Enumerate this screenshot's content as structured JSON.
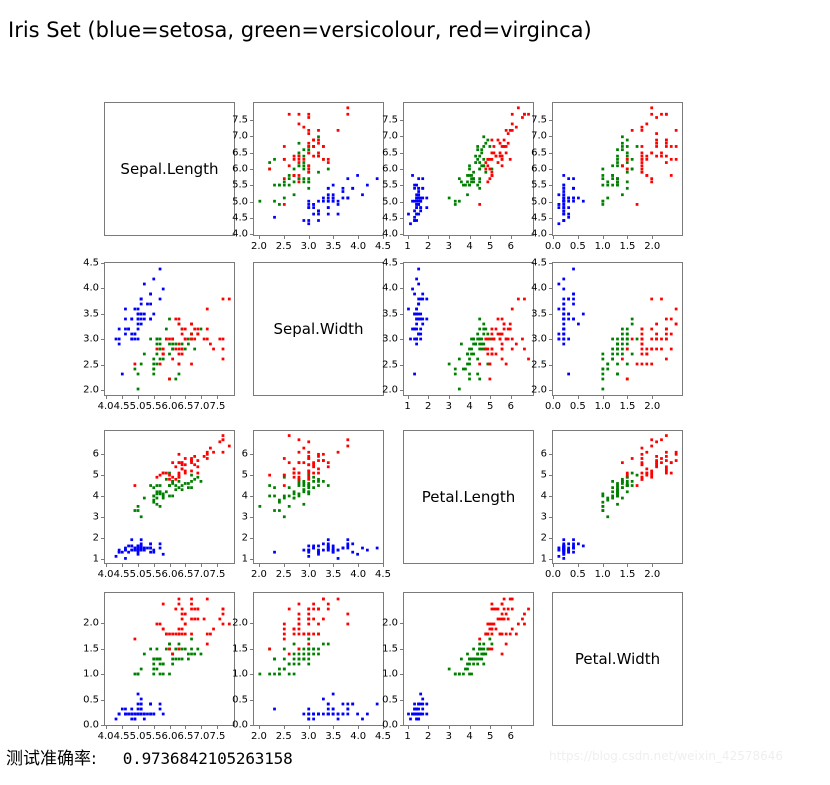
{
  "title": "Iris Set (blue=setosa, green=versicolour, red=virginca)",
  "footer": {
    "accuracy_label": "测试准确率:",
    "accuracy_value": "0.9736842105263158"
  },
  "watermark": "https://blog.csdn.net/weixin_42578646",
  "chart_data": {
    "type": "scatter",
    "layout": "scatter-plot-matrix",
    "title": "Iris Set (blue=setosa, green=versicolour, red=virginca)",
    "grid": false,
    "legend": "in-title",
    "variables": [
      "Sepal.Length",
      "Sepal.Width",
      "Petal.Length",
      "Petal.Width"
    ],
    "classes": [
      {
        "name": "setosa",
        "color": "#0000ff",
        "label": "blue=setosa"
      },
      {
        "name": "versicolour",
        "color": "#008000",
        "label": "green=versicolour"
      },
      {
        "name": "virginca",
        "color": "#ff0000",
        "label": "red=virginca"
      }
    ],
    "axes": {
      "Sepal.Length": {
        "lim": [
          3.95,
          8.05
        ],
        "ticks": [
          4.0,
          4.5,
          5.0,
          5.5,
          6.0,
          6.5,
          7.0,
          7.5
        ],
        "ticklabels": [
          "4.0",
          "4.5",
          "5.0",
          "5.5",
          "6.0",
          "6.5",
          "7.0",
          "7.5"
        ]
      },
      "Sepal.Width": {
        "lim": [
          1.88,
          4.52
        ],
        "ticks": [
          2.0,
          2.5,
          3.0,
          3.5,
          4.0,
          4.5
        ],
        "ticklabels": [
          "2.0",
          "2.5",
          "3.0",
          "3.5",
          "4.0",
          "4.5"
        ]
      },
      "Petal.Length": {
        "lim": [
          0.78,
          7.12
        ],
        "ticks": [
          1,
          2,
          3,
          4,
          5,
          6
        ],
        "ticklabels": [
          "1",
          "2",
          "3",
          "4",
          "5",
          "6"
        ]
      },
      "Petal.Width": {
        "lim": [
          -0.02,
          2.62
        ],
        "ticks": [
          0.0,
          0.5,
          1.0,
          1.5,
          2.0
        ],
        "ticklabels": [
          "0.0",
          "0.5",
          "1.0",
          "1.5",
          "2.0"
        ]
      }
    },
    "columns": [
      "sepal_length",
      "sepal_width",
      "petal_length",
      "petal_width"
    ],
    "points": [
      [
        5.1,
        3.5,
        1.4,
        0.2,
        0
      ],
      [
        4.9,
        3.0,
        1.4,
        0.2,
        0
      ],
      [
        4.7,
        3.2,
        1.3,
        0.2,
        0
      ],
      [
        4.6,
        3.1,
        1.5,
        0.2,
        0
      ],
      [
        5.0,
        3.6,
        1.4,
        0.2,
        0
      ],
      [
        5.4,
        3.9,
        1.7,
        0.4,
        0
      ],
      [
        4.6,
        3.4,
        1.4,
        0.3,
        0
      ],
      [
        5.0,
        3.4,
        1.5,
        0.2,
        0
      ],
      [
        4.4,
        2.9,
        1.4,
        0.2,
        0
      ],
      [
        4.9,
        3.1,
        1.5,
        0.1,
        0
      ],
      [
        5.4,
        3.7,
        1.5,
        0.2,
        0
      ],
      [
        4.8,
        3.4,
        1.6,
        0.2,
        0
      ],
      [
        4.8,
        3.0,
        1.4,
        0.1,
        0
      ],
      [
        4.3,
        3.0,
        1.1,
        0.1,
        0
      ],
      [
        5.8,
        4.0,
        1.2,
        0.2,
        0
      ],
      [
        5.7,
        4.4,
        1.5,
        0.4,
        0
      ],
      [
        5.4,
        3.9,
        1.3,
        0.4,
        0
      ],
      [
        5.1,
        3.5,
        1.4,
        0.3,
        0
      ],
      [
        5.7,
        3.8,
        1.7,
        0.3,
        0
      ],
      [
        5.1,
        3.8,
        1.5,
        0.3,
        0
      ],
      [
        5.4,
        3.4,
        1.7,
        0.2,
        0
      ],
      [
        5.1,
        3.7,
        1.5,
        0.4,
        0
      ],
      [
        4.6,
        3.6,
        1.0,
        0.2,
        0
      ],
      [
        5.1,
        3.3,
        1.7,
        0.5,
        0
      ],
      [
        4.8,
        3.4,
        1.9,
        0.2,
        0
      ],
      [
        5.0,
        3.0,
        1.6,
        0.2,
        0
      ],
      [
        5.0,
        3.4,
        1.6,
        0.4,
        0
      ],
      [
        5.2,
        3.5,
        1.5,
        0.2,
        0
      ],
      [
        5.2,
        3.4,
        1.4,
        0.2,
        0
      ],
      [
        4.7,
        3.2,
        1.6,
        0.2,
        0
      ],
      [
        4.8,
        3.1,
        1.6,
        0.2,
        0
      ],
      [
        5.4,
        3.4,
        1.5,
        0.4,
        0
      ],
      [
        5.2,
        4.1,
        1.5,
        0.1,
        0
      ],
      [
        5.5,
        4.2,
        1.4,
        0.2,
        0
      ],
      [
        4.9,
        3.1,
        1.5,
        0.2,
        0
      ],
      [
        5.0,
        3.2,
        1.2,
        0.2,
        0
      ],
      [
        5.5,
        3.5,
        1.3,
        0.2,
        0
      ],
      [
        4.9,
        3.6,
        1.4,
        0.1,
        0
      ],
      [
        4.4,
        3.0,
        1.3,
        0.2,
        0
      ],
      [
        5.1,
        3.4,
        1.5,
        0.2,
        0
      ],
      [
        5.0,
        3.5,
        1.3,
        0.3,
        0
      ],
      [
        4.5,
        2.3,
        1.3,
        0.3,
        0
      ],
      [
        4.4,
        3.2,
        1.3,
        0.2,
        0
      ],
      [
        5.0,
        3.5,
        1.6,
        0.6,
        0
      ],
      [
        5.1,
        3.8,
        1.9,
        0.4,
        0
      ],
      [
        4.8,
        3.0,
        1.4,
        0.3,
        0
      ],
      [
        5.1,
        3.8,
        1.6,
        0.2,
        0
      ],
      [
        4.6,
        3.2,
        1.4,
        0.2,
        0
      ],
      [
        5.3,
        3.7,
        1.5,
        0.2,
        0
      ],
      [
        5.0,
        3.3,
        1.4,
        0.2,
        0
      ],
      [
        7.0,
        3.2,
        4.7,
        1.4,
        1
      ],
      [
        6.4,
        3.2,
        4.5,
        1.5,
        1
      ],
      [
        6.9,
        3.1,
        4.9,
        1.5,
        1
      ],
      [
        5.5,
        2.3,
        4.0,
        1.3,
        1
      ],
      [
        6.5,
        2.8,
        4.6,
        1.5,
        1
      ],
      [
        5.7,
        2.8,
        4.5,
        1.3,
        1
      ],
      [
        6.3,
        3.3,
        4.7,
        1.6,
        1
      ],
      [
        4.9,
        2.4,
        3.3,
        1.0,
        1
      ],
      [
        6.6,
        2.9,
        4.6,
        1.3,
        1
      ],
      [
        5.2,
        2.7,
        3.9,
        1.4,
        1
      ],
      [
        5.0,
        2.0,
        3.5,
        1.0,
        1
      ],
      [
        5.9,
        3.0,
        4.2,
        1.5,
        1
      ],
      [
        6.0,
        2.2,
        4.0,
        1.0,
        1
      ],
      [
        6.1,
        2.9,
        4.7,
        1.4,
        1
      ],
      [
        5.6,
        2.9,
        3.6,
        1.3,
        1
      ],
      [
        6.7,
        3.1,
        4.4,
        1.4,
        1
      ],
      [
        5.6,
        3.0,
        4.5,
        1.5,
        1
      ],
      [
        5.8,
        2.7,
        4.1,
        1.0,
        1
      ],
      [
        6.2,
        2.2,
        4.5,
        1.5,
        1
      ],
      [
        5.6,
        2.5,
        3.9,
        1.1,
        1
      ],
      [
        5.9,
        3.2,
        4.8,
        1.8,
        1
      ],
      [
        6.1,
        2.8,
        4.0,
        1.3,
        1
      ],
      [
        6.3,
        2.5,
        4.9,
        1.5,
        1
      ],
      [
        6.1,
        2.8,
        4.7,
        1.2,
        1
      ],
      [
        6.4,
        2.9,
        4.3,
        1.3,
        1
      ],
      [
        6.6,
        3.0,
        4.4,
        1.4,
        1
      ],
      [
        6.8,
        2.8,
        4.8,
        1.4,
        1
      ],
      [
        6.7,
        3.0,
        5.0,
        1.7,
        1
      ],
      [
        6.0,
        2.9,
        4.5,
        1.5,
        1
      ],
      [
        5.7,
        2.6,
        3.5,
        1.0,
        1
      ],
      [
        5.5,
        2.4,
        3.8,
        1.1,
        1
      ],
      [
        5.5,
        2.4,
        3.7,
        1.0,
        1
      ],
      [
        5.8,
        2.7,
        3.9,
        1.2,
        1
      ],
      [
        6.0,
        2.7,
        5.1,
        1.6,
        1
      ],
      [
        5.4,
        3.0,
        4.5,
        1.5,
        1
      ],
      [
        6.0,
        3.4,
        4.5,
        1.6,
        1
      ],
      [
        6.7,
        3.1,
        4.7,
        1.5,
        1
      ],
      [
        6.3,
        2.3,
        4.4,
        1.3,
        1
      ],
      [
        5.6,
        3.0,
        4.1,
        1.3,
        1
      ],
      [
        5.5,
        2.5,
        4.0,
        1.3,
        1
      ],
      [
        5.5,
        2.6,
        4.4,
        1.2,
        1
      ],
      [
        6.1,
        3.0,
        4.6,
        1.4,
        1
      ],
      [
        5.8,
        2.6,
        4.0,
        1.2,
        1
      ],
      [
        5.0,
        2.3,
        3.3,
        1.0,
        1
      ],
      [
        5.6,
        2.7,
        4.2,
        1.3,
        1
      ],
      [
        5.7,
        3.0,
        4.2,
        1.2,
        1
      ],
      [
        5.7,
        2.9,
        4.2,
        1.3,
        1
      ],
      [
        6.2,
        2.9,
        4.3,
        1.3,
        1
      ],
      [
        5.1,
        2.5,
        3.0,
        1.1,
        1
      ],
      [
        5.7,
        2.8,
        4.1,
        1.3,
        1
      ],
      [
        6.3,
        3.3,
        6.0,
        2.5,
        2
      ],
      [
        5.8,
        2.7,
        5.1,
        1.9,
        2
      ],
      [
        7.1,
        3.0,
        5.9,
        2.1,
        2
      ],
      [
        6.3,
        2.9,
        5.6,
        1.8,
        2
      ],
      [
        6.5,
        3.0,
        5.8,
        2.2,
        2
      ],
      [
        7.6,
        3.0,
        6.6,
        2.1,
        2
      ],
      [
        4.9,
        2.5,
        4.5,
        1.7,
        2
      ],
      [
        7.3,
        2.9,
        6.3,
        1.8,
        2
      ],
      [
        6.7,
        2.5,
        5.8,
        1.8,
        2
      ],
      [
        7.2,
        3.6,
        6.1,
        2.5,
        2
      ],
      [
        6.5,
        3.2,
        5.1,
        2.0,
        2
      ],
      [
        6.4,
        2.7,
        5.3,
        1.9,
        2
      ],
      [
        6.8,
        3.0,
        5.5,
        2.1,
        2
      ],
      [
        5.7,
        2.5,
        5.0,
        2.0,
        2
      ],
      [
        5.8,
        2.8,
        5.1,
        2.4,
        2
      ],
      [
        6.4,
        3.2,
        5.3,
        2.3,
        2
      ],
      [
        6.5,
        3.0,
        5.5,
        1.8,
        2
      ],
      [
        7.7,
        3.8,
        6.7,
        2.2,
        2
      ],
      [
        7.7,
        2.6,
        6.9,
        2.3,
        2
      ],
      [
        6.0,
        2.2,
        5.0,
        1.5,
        2
      ],
      [
        6.9,
        3.2,
        5.7,
        2.3,
        2
      ],
      [
        5.6,
        2.8,
        4.9,
        2.0,
        2
      ],
      [
        7.7,
        2.8,
        6.7,
        2.0,
        2
      ],
      [
        6.3,
        2.7,
        4.9,
        1.8,
        2
      ],
      [
        6.7,
        3.3,
        5.7,
        2.1,
        2
      ],
      [
        7.2,
        3.2,
        6.0,
        1.8,
        2
      ],
      [
        6.2,
        2.8,
        4.8,
        1.8,
        2
      ],
      [
        6.1,
        3.0,
        4.9,
        1.8,
        2
      ],
      [
        6.4,
        2.8,
        5.6,
        2.1,
        2
      ],
      [
        7.2,
        3.0,
        5.8,
        1.6,
        2
      ],
      [
        7.4,
        2.8,
        6.1,
        1.9,
        2
      ],
      [
        7.9,
        3.8,
        6.4,
        2.0,
        2
      ],
      [
        6.4,
        2.8,
        5.6,
        2.2,
        2
      ],
      [
        6.3,
        2.8,
        5.1,
        1.5,
        2
      ],
      [
        6.1,
        2.6,
        5.6,
        1.4,
        2
      ],
      [
        7.7,
        3.0,
        6.1,
        2.3,
        2
      ],
      [
        6.3,
        3.4,
        5.6,
        2.4,
        2
      ],
      [
        6.4,
        3.1,
        5.5,
        1.8,
        2
      ],
      [
        6.0,
        3.0,
        4.8,
        1.8,
        2
      ],
      [
        6.9,
        3.1,
        5.4,
        2.1,
        2
      ],
      [
        6.7,
        3.1,
        5.6,
        2.4,
        2
      ],
      [
        6.9,
        3.1,
        5.1,
        2.3,
        2
      ],
      [
        5.8,
        2.7,
        5.1,
        1.9,
        2
      ],
      [
        6.8,
        3.2,
        5.9,
        2.3,
        2
      ],
      [
        6.7,
        3.3,
        5.7,
        2.5,
        2
      ],
      [
        6.7,
        3.0,
        5.2,
        2.3,
        2
      ],
      [
        6.3,
        2.5,
        5.0,
        1.9,
        2
      ],
      [
        6.5,
        3.0,
        5.2,
        2.0,
        2
      ],
      [
        6.2,
        3.4,
        5.4,
        2.3,
        2
      ],
      [
        5.9,
        3.0,
        5.1,
        1.8,
        2
      ]
    ]
  },
  "matrix": {
    "rows": [
      {
        "var": "Sepal.Length",
        "cells": [
          {
            "kind": "diagonal",
            "label": "Sepal.Length"
          },
          {
            "kind": "scatter",
            "x": "Sepal.Width",
            "y": "Sepal.Length"
          },
          {
            "kind": "scatter",
            "x": "Petal.Length",
            "y": "Sepal.Length"
          },
          {
            "kind": "scatter",
            "x": "Petal.Width",
            "y": "Sepal.Length"
          }
        ]
      },
      {
        "var": "Sepal.Width",
        "cells": [
          {
            "kind": "scatter",
            "x": "Sepal.Length",
            "y": "Sepal.Width"
          },
          {
            "kind": "diagonal",
            "label": "Sepal.Width"
          },
          {
            "kind": "scatter",
            "x": "Petal.Length",
            "y": "Sepal.Width"
          },
          {
            "kind": "scatter",
            "x": "Petal.Width",
            "y": "Sepal.Width"
          }
        ]
      },
      {
        "var": "Petal.Length",
        "cells": [
          {
            "kind": "scatter",
            "x": "Sepal.Length",
            "y": "Petal.Length"
          },
          {
            "kind": "scatter",
            "x": "Sepal.Width",
            "y": "Petal.Length"
          },
          {
            "kind": "diagonal",
            "label": "Petal.Length"
          },
          {
            "kind": "scatter",
            "x": "Petal.Width",
            "y": "Petal.Length"
          }
        ]
      },
      {
        "var": "Petal.Width",
        "cells": [
          {
            "kind": "scatter",
            "x": "Sepal.Length",
            "y": "Petal.Width"
          },
          {
            "kind": "scatter",
            "x": "Sepal.Width",
            "y": "Petal.Width"
          },
          {
            "kind": "scatter",
            "x": "Petal.Length",
            "y": "Petal.Width"
          },
          {
            "kind": "diagonal",
            "label": "Petal.Width"
          }
        ]
      }
    ]
  }
}
